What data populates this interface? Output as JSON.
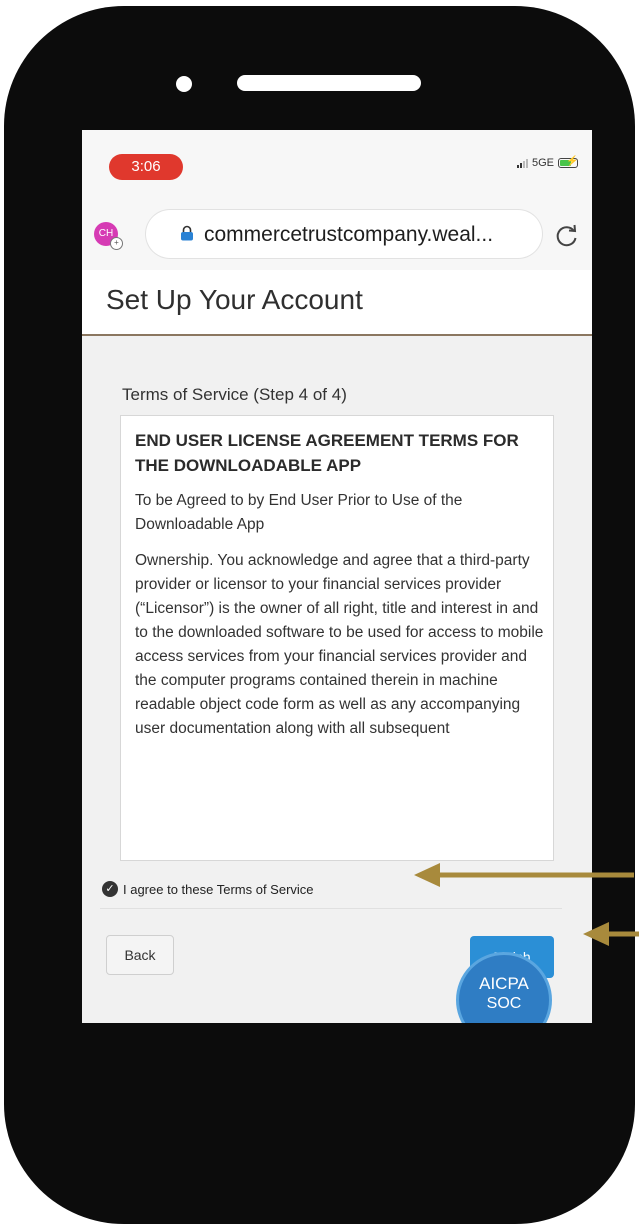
{
  "status_bar": {
    "time": "3:06",
    "network": "5GE"
  },
  "browser": {
    "avatar_initials": "CH",
    "url": "commercetrustcompany.weal..."
  },
  "page": {
    "title": "Set Up Your Account",
    "step_title": "Terms of Service (Step 4 of 4)"
  },
  "terms": {
    "heading": "END USER LICENSE AGREEMENT TERMS FOR THE DOWNLOADABLE APP",
    "subheading": "To be Agreed to by End User Prior to Use of the Downloadable App",
    "body": "Ownership. You acknowledge and agree that a third-party provider or licensor to your financial services provider (“Licensor”) is the owner of all right, title and interest in and to the downloaded software to be used for access to mobile access services from your financial services provider and the computer programs contained therein in machine readable object code form as well as any accompanying user documentation along with all subsequent"
  },
  "agreement": {
    "label": "I agree to these Terms of Service",
    "checked": true
  },
  "buttons": {
    "back": "Back",
    "finish": "Finish"
  },
  "badge": {
    "line1": "AICPA",
    "line2": "SOC"
  },
  "colors": {
    "time_pill": "#e0382d",
    "finish_button": "#2b8fd6",
    "arrow": "#a88a3c",
    "header_rule": "#8b7760"
  },
  "icons": [
    "lock-icon",
    "reload-icon",
    "signal-icon",
    "battery-icon",
    "check-icon",
    "arrow-left-icon"
  ]
}
